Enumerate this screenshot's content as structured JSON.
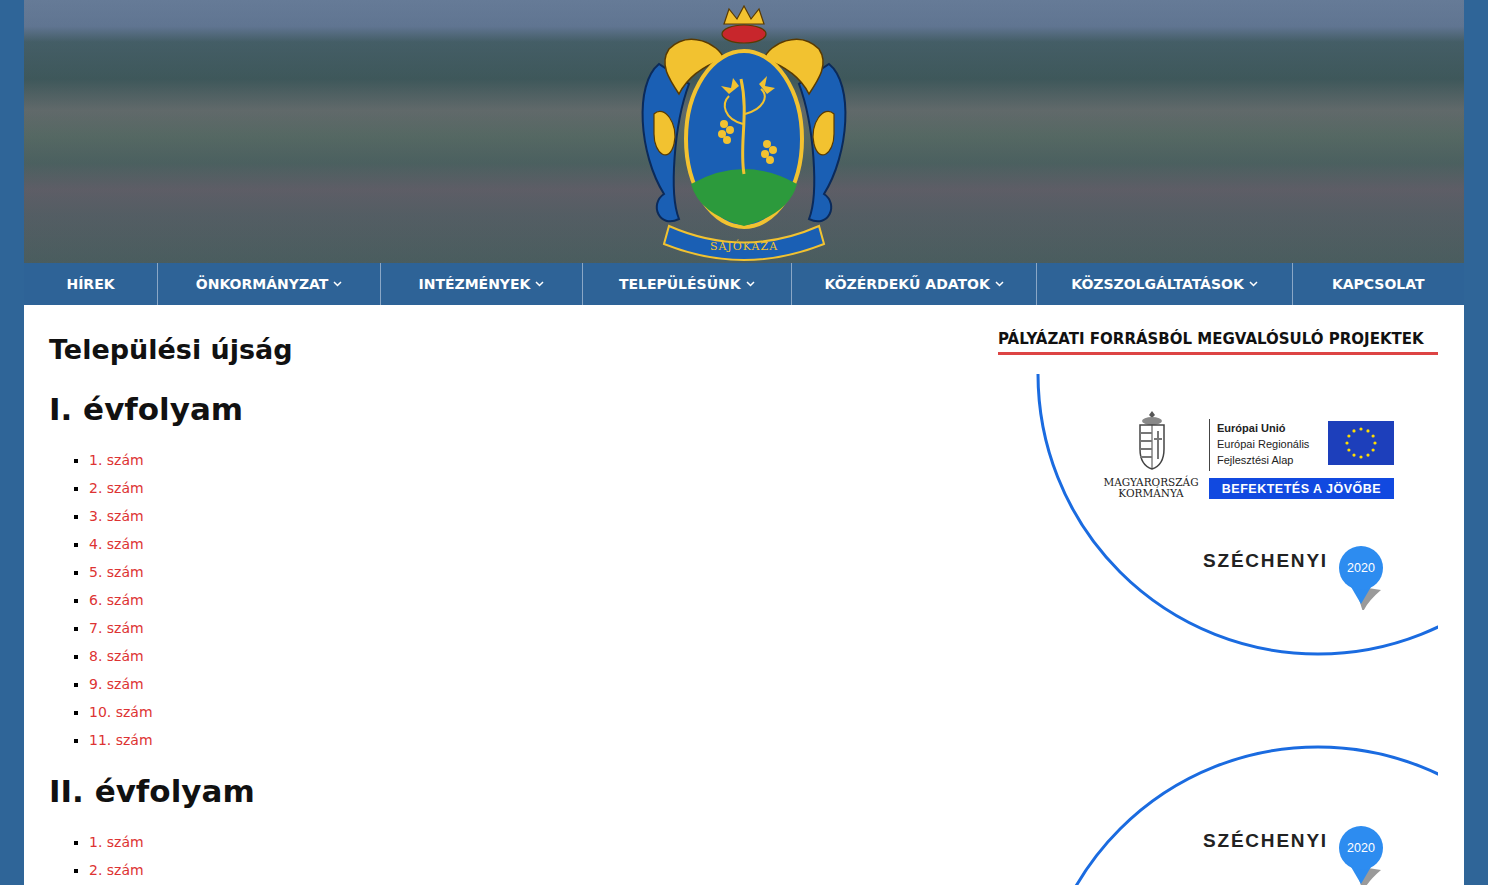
{
  "header": {
    "logo_text": "SAJÓKAZA"
  },
  "nav": [
    {
      "label": "HÍREK",
      "has_dropdown": false
    },
    {
      "label": "ÖNKORMÁNYZAT",
      "has_dropdown": true
    },
    {
      "label": "INTÉZMÉNYEK",
      "has_dropdown": true
    },
    {
      "label": "TELEPÜLÉSÜNK",
      "has_dropdown": true
    },
    {
      "label": "KÖZÉRDEKŰ ADATOK",
      "has_dropdown": true
    },
    {
      "label": "KÖZSZOLGÁLTATÁSOK",
      "has_dropdown": true
    },
    {
      "label": "KAPCSOLAT",
      "has_dropdown": false
    }
  ],
  "page_title": "Települési újság",
  "volumes": [
    {
      "title": "I. évfolyam",
      "issues": [
        "1. szám",
        "2. szám",
        "3. szám",
        "4. szám",
        "5. szám",
        "6. szám",
        "7. szám",
        "8. szám",
        "9. szám",
        "10. szám",
        "11. szám"
      ]
    },
    {
      "title": "II. évfolyam",
      "issues": [
        "1. szám",
        "2. szám"
      ]
    }
  ],
  "sidebar": {
    "title": "PÁLYÁZATI FORRÁSBÓL MEGVALÓSULÓ PROJEKTEK",
    "banners": [
      {
        "kind": "full",
        "gov_lines": [
          "MAGYARORSZÁG",
          "KORMÁNYA"
        ],
        "eu_lines": [
          "Európai Unió",
          "Európai Regionális",
          "Fejlesztési Alap"
        ],
        "button": "BEFEKTETÉS A JÖVŐBE",
        "brand": "SZÉCHENYI",
        "year": "2020"
      },
      {
        "kind": "brand",
        "brand": "SZÉCHENYI",
        "year": "2020"
      }
    ]
  }
}
